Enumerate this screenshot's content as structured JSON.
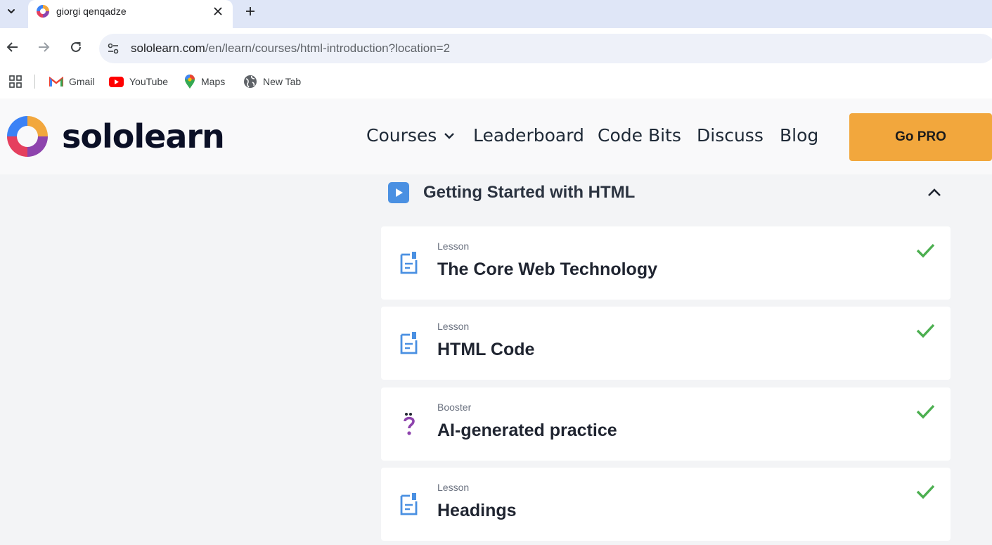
{
  "browser": {
    "tab_title": "giorgi qenqadze",
    "url_host": "sololearn.com",
    "url_path": "/en/learn/courses/html-introduction?location=2",
    "bookmarks": [
      {
        "label": "Gmail",
        "icon": "gmail-icon"
      },
      {
        "label": "YouTube",
        "icon": "youtube-icon"
      },
      {
        "label": "Maps",
        "icon": "maps-icon"
      },
      {
        "label": "New Tab",
        "icon": "globe-icon"
      }
    ]
  },
  "site": {
    "logo_text": "sololearn",
    "nav": {
      "courses": "Courses",
      "leaderboard": "Leaderboard",
      "code_bits": "Code Bits",
      "discuss": "Discuss",
      "blog": "Blog"
    },
    "go_pro": "Go PRO",
    "accent": "#f2a73d"
  },
  "module": {
    "title": "Getting Started with HTML",
    "items": [
      {
        "type": "Lesson",
        "title": "The Core Web Technology",
        "icon": "document-icon",
        "completed": true
      },
      {
        "type": "Lesson",
        "title": "HTML Code",
        "icon": "document-icon",
        "completed": true
      },
      {
        "type": "Booster",
        "title": "AI-generated practice",
        "icon": "question-mark-icon",
        "completed": true
      },
      {
        "type": "Lesson",
        "title": "Headings",
        "icon": "document-icon",
        "completed": true
      }
    ]
  }
}
